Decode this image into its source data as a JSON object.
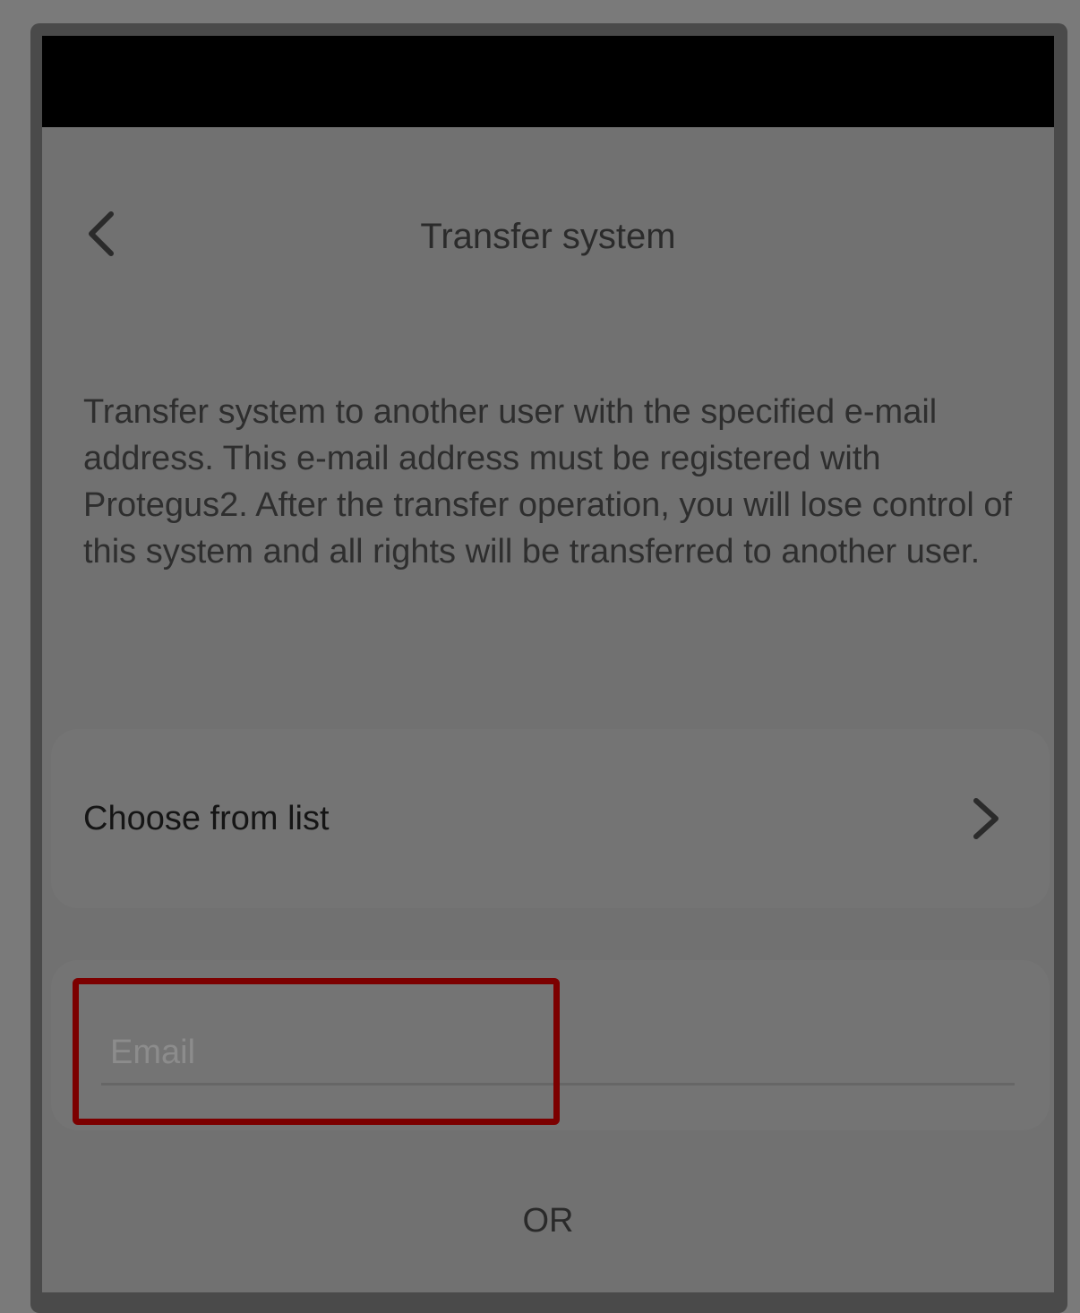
{
  "header": {
    "title": "Transfer system",
    "back_icon": "chevron-left-icon"
  },
  "description": "Transfer system to another user with the specified e-mail address. This e-mail address must be registered with Protegus2. After the transfer operation, you will lose control of this system and all rights will be transferred to another user.",
  "choose_from_list": {
    "label": "Choose from list",
    "icon": "chevron-right-icon"
  },
  "email": {
    "placeholder": "Email",
    "value": ""
  },
  "divider_text": "OR",
  "colors": {
    "highlight": "#7c0000",
    "status_bar": "#000000",
    "overlay_bg": "#717171"
  }
}
